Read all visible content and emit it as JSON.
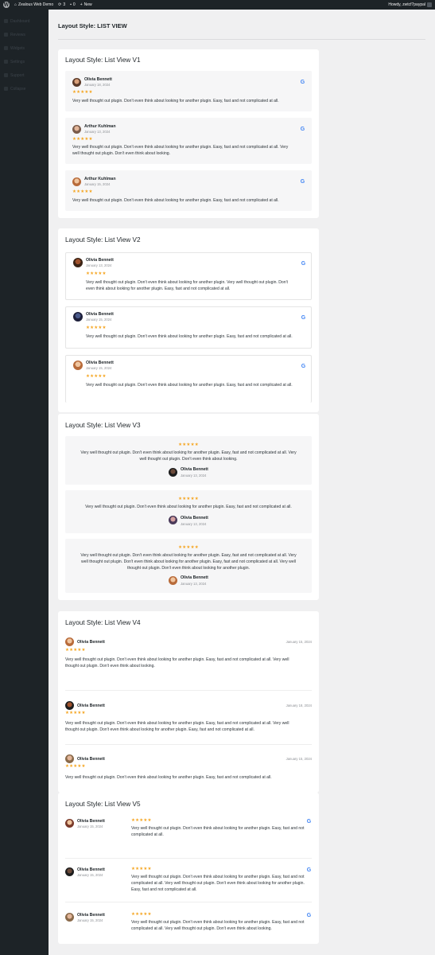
{
  "adminbar": {
    "site_name": "Zealous Web Demo",
    "updates_count": "3",
    "comments_count": "0",
    "new_label": "New",
    "howdy": "Howdy, zwtcf7paypal"
  },
  "sidebar": {
    "items": [
      {
        "label": "Dashboard"
      },
      {
        "label": "Reviews"
      },
      {
        "label": "Widgets"
      },
      {
        "label": "Settings"
      },
      {
        "label": "Support"
      },
      {
        "label": "Collapse"
      }
    ]
  },
  "page_title": "Layout Style: LIST VIEW",
  "stars": "★★★★★",
  "google_label": "G",
  "colors": {
    "star": "#f5a623",
    "google_blue": "#4285F4"
  },
  "v1": {
    "title": "Layout Style: List View V1",
    "items": [
      {
        "name": "Olivia Bennett",
        "date": "January 18, 2024",
        "text": "Very well thought out plugin. Don't even think about looking for another plugin. Easy, fast and not complicated at all."
      },
      {
        "name": "Arthur Kuhlman",
        "date": "January 13, 2024",
        "text1": "Very well thought out plugin. Don't even think about looking for another plugin. Easy, fast and not complicated at all. Very",
        "text2": "well thought out plugin. Don't even think about looking."
      },
      {
        "name": "Arthur Kuhlman",
        "date": "January 15, 2024",
        "text": "Very well thought out plugin. Don't even think about looking for another plugin. Easy, fast and not complicated at all."
      }
    ]
  },
  "v2": {
    "title": "Layout Style: List View V2",
    "items": [
      {
        "name": "Olivia Bennett",
        "date": "January 13, 2024",
        "text1": "Very well thought out plugin. Don't even think about looking for another plugin. Very well thought out plugin. Don't",
        "text2": "even think about looking for another plugin. Easy, fast and not complicated at all."
      },
      {
        "name": "Olivia Bennett",
        "date": "January 15, 2024",
        "text": "Very well thought out plugin. Don't even think about looking for another plugin. Easy, fast and not complicated at all."
      },
      {
        "name": "Olivia Bennett",
        "date": "January 15, 2024",
        "text": "Very well thought out plugin. Don't even think about looking for another plugin. Easy, fast and not complicated at all."
      }
    ]
  },
  "v3": {
    "title": "Layout Style: List View V3",
    "items": [
      {
        "name": "Olivia Bennett",
        "date": "January 13, 2024",
        "text1": "Very well thought out plugin. Don't even think about looking for another plugin. Easy, fast and not complicated at all. Very",
        "text2": "well thought out plugin. Don't even think about looking."
      },
      {
        "name": "Olivia Bennett",
        "date": "January 13, 2024",
        "text": "Very well thought out plugin. Don't even think about looking for another plugin. Easy, fast and not complicated at all."
      },
      {
        "name": "Olivia Bennett",
        "date": "January 13, 2024",
        "text1": "Very well thought out plugin. Don't even think about looking for another plugin. Easy, fast and not complicated at all. Very",
        "text2": "well thought out plugin. Don't even think about looking for another plugin. Easy, fast and not complicated at all. Very well",
        "text3": "thought out plugin. Don't even think about looking for another plugin."
      }
    ]
  },
  "v4": {
    "title": "Layout Style: List View V4",
    "items": [
      {
        "name": "Olivia Bennett",
        "date": "January 15, 2024",
        "text1": "Very well thought out plugin. Don't even think about looking for another plugin. Easy, fast and not complicated at all. Very well",
        "text2": "thought out plugin. Don't even think about looking."
      },
      {
        "name": "Olivia Bennett",
        "date": "January 18, 2024",
        "text1": "Very well thought out plugin. Don't even think about looking for another plugin. Easy, fast and not complicated at all. Very well",
        "text2": "thought out plugin. Don't even think about looking for another plugin. Easy, fast and not complicated at all."
      },
      {
        "name": "Olivia Bennett",
        "date": "January 15, 2024",
        "text": "Very well thought out plugin. Don't even think about looking for another plugin. Easy, fast and not complicated at all."
      }
    ]
  },
  "v5": {
    "title": "Layout Style: List View V5",
    "items": [
      {
        "name": "Olivia Bennett",
        "date": "January 15, 2024",
        "text1": "Very well thought out plugin. Don't even think about looking for another plugin. Easy, fast and not",
        "text2": "complicated at all."
      },
      {
        "name": "Olivia Bennett",
        "date": "January 15, 2024",
        "text1": "Very well thought out plugin. Don't even think about looking for another plugin. Easy, fast and not",
        "text2": "complicated at all. Very well thought out plugin. Don't even think about looking for another plugin.",
        "text3": "Easy, fast and not complicated at all."
      },
      {
        "name": "Olivia Bennett",
        "date": "January 15, 2024",
        "text1": "Very well thought out plugin. Don't even think about looking for another plugin. Easy, fast and not",
        "text2": "complicated at all. Very well thought out plugin. Don't even think about looking."
      }
    ]
  }
}
